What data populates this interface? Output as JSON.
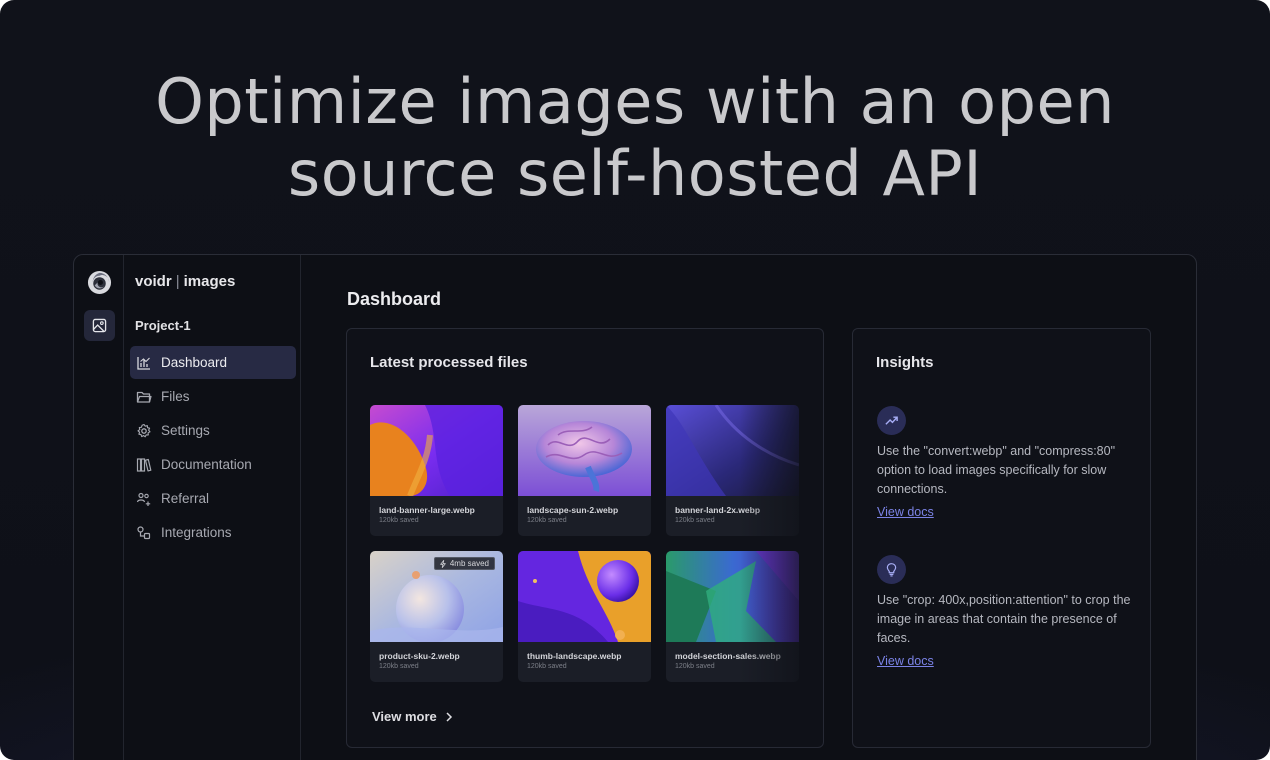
{
  "headline": {
    "line1": "Optimize images with an open",
    "line2": "source self-hosted API"
  },
  "app": {
    "brand": {
      "name": "voidr",
      "separator": "|",
      "product": "images"
    },
    "rail": {
      "logo_icon": "voidr-swirl-logo-icon",
      "active_icon": "image-icon"
    },
    "project": "Project-1",
    "nav": [
      {
        "label": "Dashboard",
        "icon": "bar-chart-icon",
        "active": true
      },
      {
        "label": "Files",
        "icon": "folder-icon",
        "active": false
      },
      {
        "label": "Settings",
        "icon": "gear-icon",
        "active": false
      },
      {
        "label": "Documentation",
        "icon": "books-icon",
        "active": false
      },
      {
        "label": "Referral",
        "icon": "users-plus-icon",
        "active": false
      },
      {
        "label": "Integrations",
        "icon": "integrations-icon",
        "active": false
      }
    ],
    "main": {
      "title": "Dashboard",
      "files_card": {
        "title": "Latest processed files",
        "files": [
          {
            "name": "land-banner-large.webp",
            "saved": "120kb saved"
          },
          {
            "name": "landscape-sun-2.webp",
            "saved": "120kb saved"
          },
          {
            "name": "banner-land-2x.webp",
            "saved": "120kb saved"
          },
          {
            "name": "product-sku-2.webp",
            "saved": "120kb saved",
            "badge": "4mb saved"
          },
          {
            "name": "thumb-landscape.webp",
            "saved": "120kb saved"
          },
          {
            "name": "model-section-sales.webp",
            "saved": "120kb saved"
          }
        ],
        "view_more": "View more"
      },
      "insights_card": {
        "title": "Insights",
        "items": [
          {
            "icon": "trending-up-icon",
            "text": "Use the \"convert:webp\" and \"compress:80\" option to load images specifically for slow connections.",
            "link": "View docs"
          },
          {
            "icon": "lightbulb-icon",
            "text": "Use \"crop: 400x,position:attention\" to crop the image in areas that contain the presence of faces.",
            "link": "View docs"
          }
        ]
      }
    }
  },
  "colors": {
    "background": "#10121a",
    "headline": "#c9c9cc",
    "accent": "#7b83e6",
    "active_nav": "#272a44"
  }
}
